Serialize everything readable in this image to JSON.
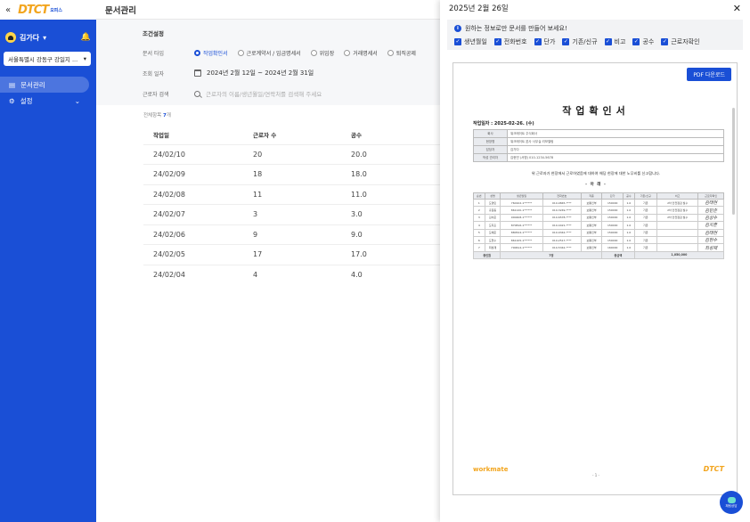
{
  "app": {
    "logo_text": "DTCT",
    "logo_sub": "오피스",
    "collapse_icon": "«"
  },
  "sidebar": {
    "user_name": "김가다",
    "site": "서울특별시 강동구 강일지 ...",
    "items": [
      {
        "label": "문서관리",
        "icon": "document-icon",
        "active": true
      },
      {
        "label": "설정",
        "icon": "gear-icon",
        "active": false
      }
    ]
  },
  "header": {
    "title": "문서관리"
  },
  "filter": {
    "section_title": "조건설정",
    "doc_type_label": "문서 타입",
    "doc_types": [
      {
        "label": "작업확인서",
        "selected": true
      },
      {
        "label": "근로계약서 / 임금명세서",
        "selected": false
      },
      {
        "label": "위임장",
        "selected": false
      },
      {
        "label": "거래명세서",
        "selected": false
      },
      {
        "label": "퇴직공제",
        "selected": false
      }
    ],
    "period_label": "조회 일자",
    "period_value": "2024년 2월 12일 ~ 2024년 2월 31일",
    "search_label": "근로자 검색",
    "search_placeholder": "근로자의 이름/생년월일/연락처를 검색해 주세요"
  },
  "list": {
    "total_prefix": "전체항목",
    "total_count": "7",
    "total_suffix": "개",
    "headers": [
      "작업일",
      "근로자 수",
      "공수"
    ],
    "rows": [
      {
        "date": "24/02/10",
        "workers": "20",
        "mandays": "20.0"
      },
      {
        "date": "24/02/09",
        "workers": "18",
        "mandays": "18.0"
      },
      {
        "date": "24/02/08",
        "workers": "11",
        "mandays": "11.0"
      },
      {
        "date": "24/02/07",
        "workers": "3",
        "mandays": "3.0"
      },
      {
        "date": "24/02/06",
        "workers": "9",
        "mandays": "9.0"
      },
      {
        "date": "24/02/05",
        "workers": "17",
        "mandays": "17.0"
      },
      {
        "date": "24/02/04",
        "workers": "4",
        "mandays": "4.0"
      }
    ]
  },
  "panel": {
    "title": "2025년 2월 26일",
    "close_icon": "✕",
    "hint": "원하는 정보로만 문서를 만들어 보세요!",
    "options": [
      "생년월일",
      "전화번호",
      "단가",
      "기존/신규",
      "비고",
      "공수",
      "근로자확인"
    ],
    "pdf_button": "PDF 다운로드",
    "doc": {
      "title": "작업확인서",
      "date_line": "작업일자 : 2025-02-26. (수)",
      "info": [
        {
          "k": "회사",
          "v": "워크메이트 주식회사"
        },
        {
          "k": "현장명",
          "v": "워크메이트 본사 사무실 리모델링"
        },
        {
          "k": "담당자",
          "v": "김가다"
        },
        {
          "k": "작성 관리자",
          "v": "김현민 (서명) 010-1234-5678"
        }
      ],
      "confirm_text": "위 근로자가 현장에서 근로하였음에 대하여 해당 현장에 대한 노무비를 신고합니다.",
      "below": "- 아 래 -",
      "work_headers": [
        "순번",
        "성명",
        "생년월일",
        "전화번호",
        "직종",
        "단가",
        "공수",
        "기존/신규",
        "비고",
        "근로자확인"
      ],
      "work_rows": [
        {
          "no": "1",
          "name": "도영민",
          "birth": "760102-1******",
          "phone": "010-9845-****",
          "job": "보통인부",
          "price": "150000",
          "md": "1.0",
          "type": "기존",
          "note": "2차 안전점검 필수",
          "sig": "김태현"
        },
        {
          "no": "2",
          "name": "홍길동",
          "birth": "861120-1******",
          "phone": "010-3249-****",
          "job": "보통인부",
          "price": "150000",
          "md": "1.0",
          "type": "기존",
          "note": "2차 안전점검 필수",
          "sig": "김민준"
        },
        {
          "no": "3",
          "name": "김서준",
          "birth": "900408-1******",
          "phone": "010-6578-****",
          "job": "보통인부",
          "price": "150000",
          "md": "1.0",
          "type": "기존",
          "note": "2차 안전점검 필수",
          "sig": "김상수"
        },
        {
          "no": "4",
          "name": "도지훈",
          "birth": "870816-1******",
          "phone": "010-4421-****",
          "job": "보통인부",
          "price": "150000",
          "md": "1.0",
          "type": "기존",
          "note": "",
          "sig": "김지훈"
        },
        {
          "no": "5",
          "name": "도예준",
          "birth": "880524-1******",
          "phone": "010-9342-****",
          "job": "보통인부",
          "price": "150000",
          "md": "1.0",
          "type": "기존",
          "note": "",
          "sig": "김태현"
        },
        {
          "no": "6",
          "name": "도현수",
          "birth": "861105-1******",
          "phone": "010-2517-****",
          "job": "보통인부",
          "price": "150000",
          "md": "1.0",
          "type": "기존",
          "note": "",
          "sig": "김현수"
        },
        {
          "no": "7",
          "name": "최성재",
          "birth": "790614-1******",
          "phone": "010-5342-****",
          "job": "보통인부",
          "price": "160000",
          "md": "1.0",
          "type": "기존",
          "note": "",
          "sig": "최성재"
        }
      ],
      "total_label": "총인원",
      "total_people": "7명",
      "total_amount_label": "총금액",
      "total_amount": "1,050,000",
      "footer_logo": "workmate",
      "footer_page": "- 1 -",
      "footer_brand": "DTCT"
    }
  },
  "chat": {
    "label": "채팅상담"
  }
}
